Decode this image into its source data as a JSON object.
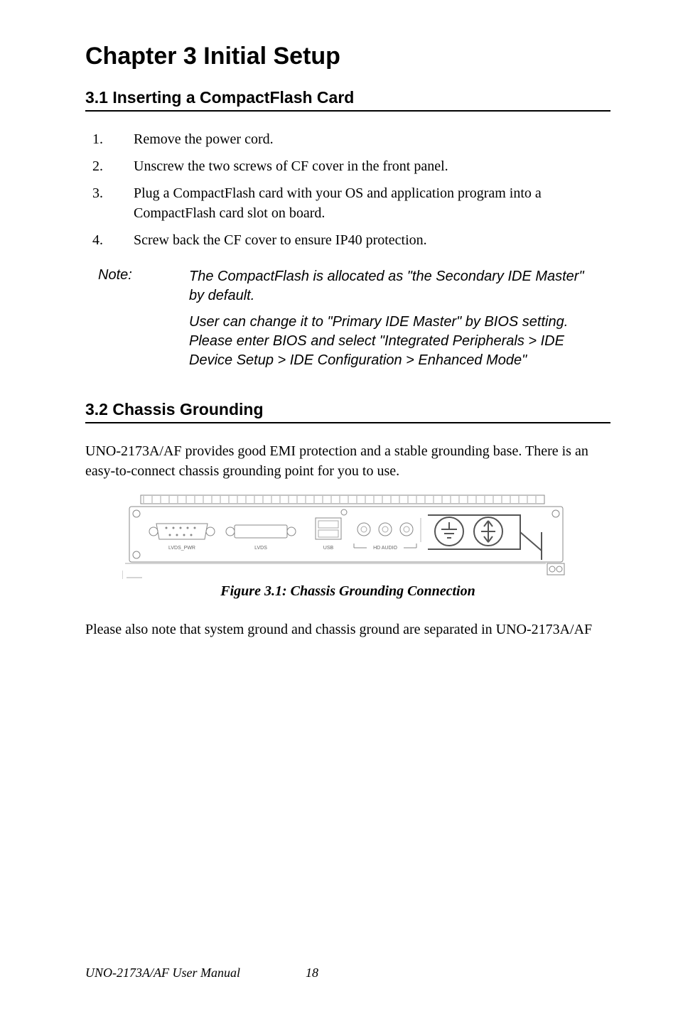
{
  "chapter": {
    "title": "Chapter 3  Initial Setup"
  },
  "sections": {
    "s1": {
      "heading": "3.1  Inserting a CompactFlash Card"
    },
    "s2": {
      "heading": "3.2  Chassis Grounding"
    }
  },
  "steps": [
    {
      "num": "1.",
      "text": "Remove the power cord."
    },
    {
      "num": "2.",
      "text": "Unscrew the two screws of CF cover in the front panel."
    },
    {
      "num": "3.",
      "text": "Plug a CompactFlash card with your OS and application program into a CompactFlash card slot on board."
    },
    {
      "num": "4.",
      "text": "Screw back the CF cover to ensure IP40 protection."
    }
  ],
  "note": {
    "label": "Note:",
    "p1": "The CompactFlash is allocated as \"the Secondary IDE Master\" by default.",
    "p2": "User can change it to \"Primary IDE Master\" by BIOS setting. Please enter BIOS and select \"Integrated Peripherals  > IDE Device Setup > IDE Configuration > Enhanced Mode\""
  },
  "grounding": {
    "para1": "UNO-2173A/AF provides good EMI protection and a stable grounding base. There is an easy-to-connect chassis grounding point for you to use.",
    "para2": "Please also note that system ground and chassis ground are separated in UNO-2173A/AF"
  },
  "figure": {
    "caption": "Figure 3.1: Chassis Grounding Connection",
    "labels": {
      "lvds_pwr": "LVDS_PWR",
      "lvds": "LVDS",
      "usb": "USB",
      "hd_audio": "HD AUDIO"
    }
  },
  "footer": {
    "title": "UNO-2173A/AF User Manual",
    "page": "18"
  }
}
